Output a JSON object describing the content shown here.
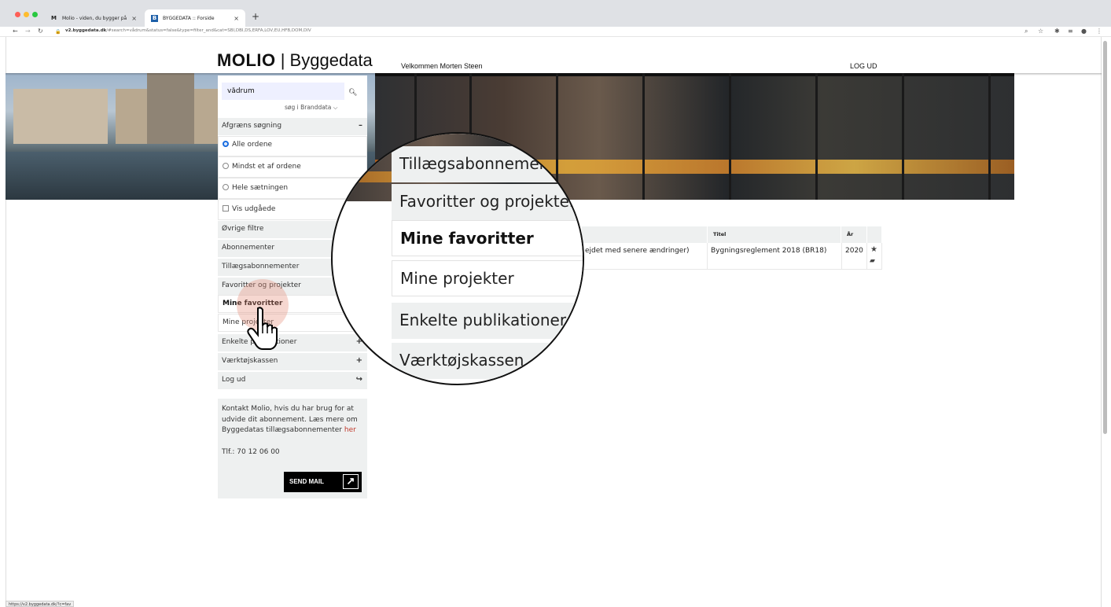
{
  "browser": {
    "tabs": [
      {
        "label": "Molio - viden, du bygger på",
        "favicon": "M"
      },
      {
        "label": "BYGGEDATA :: Forside",
        "favicon": "B"
      }
    ],
    "url_domain": "v2.byggedata.dk",
    "url_path": "/#search=vådrum&status=false&type=filter_and&cat=SBI,DBI,DS,ERFA,LOV,EU,HFB,DOM,DIV",
    "status_url": "https://v2.byggedata.dk/?c=fav"
  },
  "header": {
    "logo_brand": "MOLIO",
    "logo_product": "| Byggedata",
    "welcome": "Velkommen Morten Steen",
    "logout": "LOG UD"
  },
  "search": {
    "value": "vådrum",
    "search_in": "søg i Branddata ⌵"
  },
  "sidebar": {
    "refine_label": "Afgræns søgning",
    "refine_toggle": "–",
    "radio_all": "Alle ordene",
    "radio_any": "Mindst et af ordene",
    "radio_phrase": "Hele sætningen",
    "check_expired": "Vis udgåede",
    "items": [
      {
        "label": "Øvrige filtre",
        "toggle": ""
      },
      {
        "label": "Abonnementer",
        "toggle": ""
      },
      {
        "label": "Tillægsabonnementer",
        "toggle": ""
      },
      {
        "label": "Favoritter og projekter",
        "toggle": ""
      },
      {
        "label": "Mine favoritter",
        "toggle": ""
      },
      {
        "label": "Mine projekter",
        "toggle": ""
      },
      {
        "label": "Enkelte publikationer",
        "toggle": "+"
      },
      {
        "label": "Værktøjskassen",
        "toggle": "+"
      },
      {
        "label": "Log ud",
        "toggle": "↪"
      }
    ]
  },
  "contact": {
    "text": "Kontakt Molio, hvis du har brug for at udvide dit abonnement. Læs mere om Byggedatas tillægsabonnementer ",
    "link": "her",
    "phone": "Tlf.: 70 12 06 00",
    "send_mail": "SEND MAIL",
    "send_icon": "↗"
  },
  "results": {
    "columns": [
      "Titel",
      "År"
    ],
    "row": {
      "desc": "ejdet med senere ændringer)",
      "title": "Bygningsreglement 2018 (BR18)",
      "year": "2020",
      "star": "★",
      "folder": "📂"
    }
  },
  "magnifier": {
    "rows": [
      "Tillægsabonnementer",
      "Favoritter og projekter",
      "Mine favoritter",
      "Mine projekter",
      "Enkelte publikationer",
      "Værktøjskassen"
    ]
  }
}
